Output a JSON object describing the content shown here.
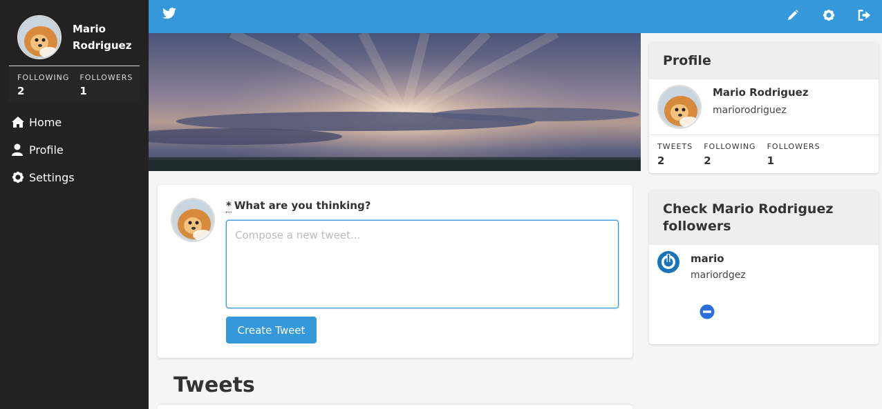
{
  "user": {
    "name": "Mario Rodriguez",
    "handle": "mariorodriguez"
  },
  "sidebar": {
    "name_line1": "Mario",
    "name_line2": "Rodriguez",
    "stats": [
      {
        "label": "FOLLOWING",
        "value": "2"
      },
      {
        "label": "FOLLOWERS",
        "value": "1"
      }
    ],
    "nav": [
      {
        "label": "Home",
        "icon": "home-icon"
      },
      {
        "label": "Profile",
        "icon": "user-icon"
      },
      {
        "label": "Settings",
        "icon": "gear-icon"
      }
    ]
  },
  "topbar": {
    "logo": "twitter-bird-icon",
    "actions": [
      "pencil-icon",
      "gear-icon",
      "sign-out-icon"
    ]
  },
  "compose": {
    "required_mark": "*",
    "label": "What are you thinking?",
    "placeholder": "Compose a new tweet...",
    "value": "",
    "button": "Create Tweet"
  },
  "tweets": {
    "title": "Tweets"
  },
  "profile_card": {
    "title": "Profile",
    "name": "Mario Rodriguez",
    "handle": "mariorodriguez",
    "stats": [
      {
        "label": "TWEETS",
        "value": "2"
      },
      {
        "label": "FOLLOWING",
        "value": "2"
      },
      {
        "label": "FOLLOWERS",
        "value": "1"
      }
    ]
  },
  "followers_card": {
    "title": "Check Mario Rodriguez followers",
    "followers": [
      {
        "name": "mario",
        "handle": "mariordgez"
      }
    ]
  },
  "colors": {
    "brand": "#3498db",
    "sidebar": "#222222",
    "remove": "#2a6fdb",
    "follower_avatar": "#1a73b8"
  }
}
